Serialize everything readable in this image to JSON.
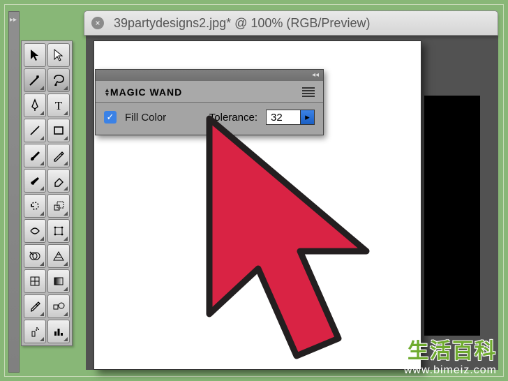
{
  "tab": {
    "title": "39partydesigns2.jpg* @ 100% (RGB/Preview)",
    "close_glyph": "×"
  },
  "panel": {
    "name": "MAGIC WAND",
    "fill_color_label": "Fill Color",
    "fill_color_checked": true,
    "tolerance_label": "Tolerance:",
    "tolerance_value": "32"
  },
  "tools": [
    {
      "id": "selection-tool",
      "icon": "arrow-black"
    },
    {
      "id": "direct-selection-tool",
      "icon": "arrow-white"
    },
    {
      "id": "magic-wand-tool",
      "icon": "wand",
      "selected": true
    },
    {
      "id": "lasso-tool",
      "icon": "lasso",
      "selected": true
    },
    {
      "id": "pen-tool",
      "icon": "pen"
    },
    {
      "id": "type-tool",
      "icon": "type"
    },
    {
      "id": "line-segment-tool",
      "icon": "line"
    },
    {
      "id": "rectangle-tool",
      "icon": "rect"
    },
    {
      "id": "paintbrush-tool",
      "icon": "brush"
    },
    {
      "id": "pencil-tool",
      "icon": "pencil"
    },
    {
      "id": "blob-brush-tool",
      "icon": "blob"
    },
    {
      "id": "eraser-tool",
      "icon": "eraser"
    },
    {
      "id": "rotate-tool",
      "icon": "rotate"
    },
    {
      "id": "scale-tool",
      "icon": "scale"
    },
    {
      "id": "width-tool",
      "icon": "width"
    },
    {
      "id": "free-transform-tool",
      "icon": "freetrans"
    },
    {
      "id": "shape-builder-tool",
      "icon": "shapebuild"
    },
    {
      "id": "perspective-grid-tool",
      "icon": "perspective"
    },
    {
      "id": "mesh-tool",
      "icon": "mesh"
    },
    {
      "id": "gradient-tool",
      "icon": "gradient"
    },
    {
      "id": "eyedropper-tool",
      "icon": "eyedrop"
    },
    {
      "id": "blend-tool",
      "icon": "blend"
    },
    {
      "id": "symbol-sprayer-tool",
      "icon": "spray"
    },
    {
      "id": "column-graph-tool",
      "icon": "graph"
    }
  ],
  "watermark": {
    "zh": "生活百科",
    "url": "www.bimeiz.com"
  }
}
